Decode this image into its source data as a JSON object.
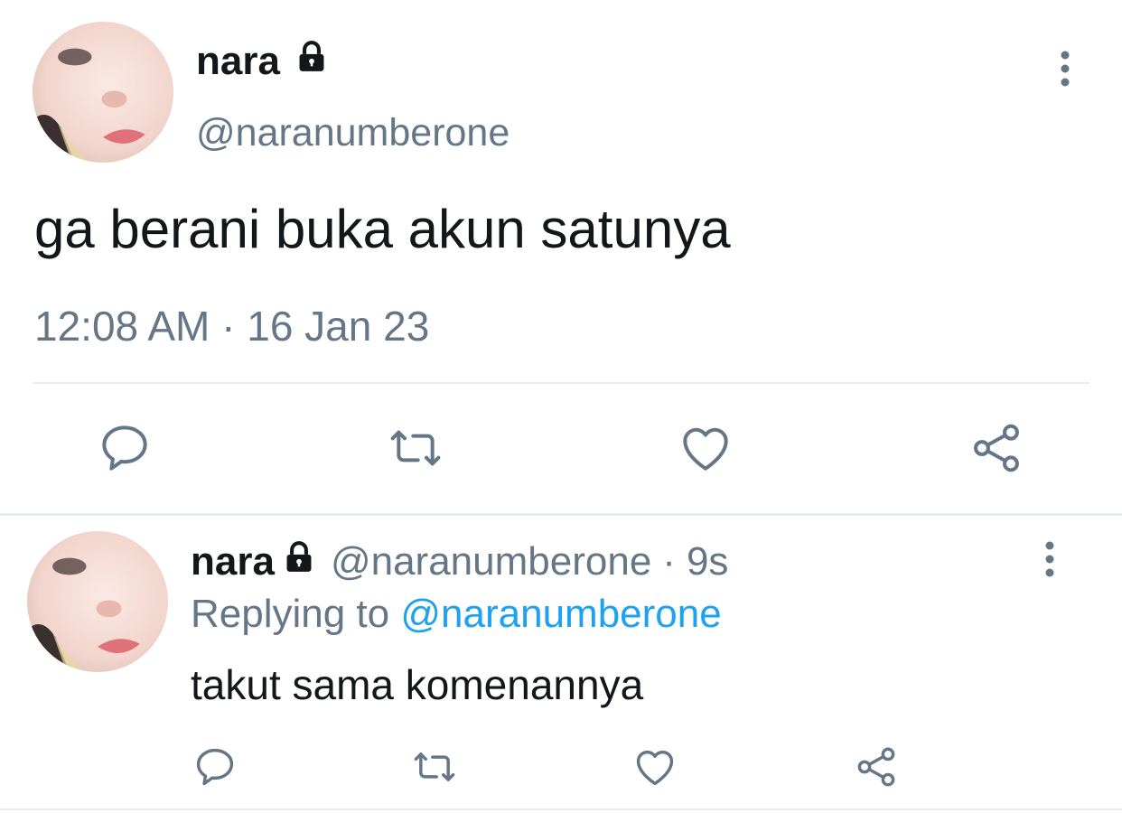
{
  "main_tweet": {
    "display_name": "nara",
    "handle": "@naranumberone",
    "text": "ga berani buka akun satunya",
    "timestamp": "12:08 AM · 16 Jan 23",
    "locked": true
  },
  "reply_tweet": {
    "display_name": "nara",
    "handle": "@naranumberone",
    "separator": "·",
    "time_ago": "9s",
    "replying_label": "Replying to",
    "replying_to_handle": "@naranumberone",
    "text": "takut sama komenannya",
    "locked": true
  },
  "icons": {
    "reply": "comment-bubble-icon",
    "retweet": "retweet-icon",
    "like": "heart-icon",
    "share": "share-icon",
    "more": "vertical-dots-icon",
    "lock": "lock-icon"
  },
  "colors": {
    "text_primary": "#14171a",
    "text_secondary": "#657786",
    "link": "#1da1f2",
    "divider": "#e6ecf0"
  }
}
